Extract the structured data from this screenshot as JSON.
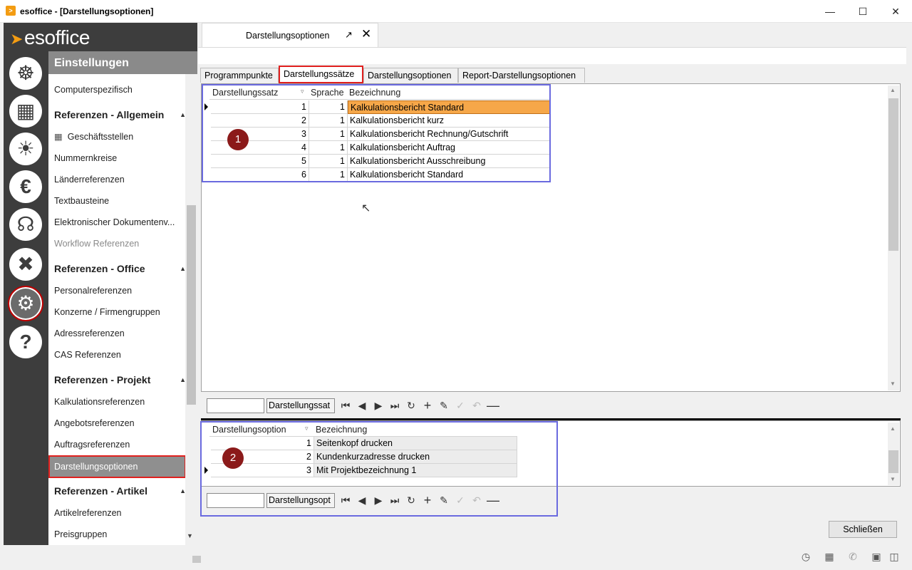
{
  "window": {
    "title": "esoffice - [Darstellungsoptionen]",
    "app_icon": "app-icon",
    "controls": [
      "minimize-icon",
      "maximize-icon",
      "close-icon"
    ]
  },
  "brand": {
    "logo_text": "esoffice",
    "accent": "#f39c12",
    "rail_color": "#3d3d3d"
  },
  "rail_icons": [
    {
      "name": "helm-icon",
      "glyph": "☸"
    },
    {
      "name": "calculator-icon",
      "glyph": "▦"
    },
    {
      "name": "alarm-light-icon",
      "glyph": "☀"
    },
    {
      "name": "euro-icon",
      "glyph": "€"
    },
    {
      "name": "headset-icon",
      "glyph": "☊"
    },
    {
      "name": "tools-icon",
      "glyph": "✖"
    },
    {
      "name": "gears-icon",
      "glyph": "⚙",
      "active": true
    },
    {
      "name": "help-icon",
      "glyph": "?"
    }
  ],
  "sidebar": {
    "header": "Einstellungen",
    "items": {
      "computerspezifisch": "Computerspezifisch",
      "group_allgemein": "Referenzen - Allgemein",
      "geschaeftsstellen": "Geschäftsstellen",
      "nummernkreise": "Nummernkreise",
      "laenderreferenzen": "Länderreferenzen",
      "textbausteine": "Textbausteine",
      "dokumentenv": "Elektronischer Dokumentenv...",
      "workflow": "Workflow Referenzen",
      "group_office": "Referenzen - Office",
      "personalreferenzen": "Personalreferenzen",
      "konzerne": "Konzerne / Firmengruppen",
      "adressreferenzen": "Adressreferenzen",
      "cas": "CAS Referenzen",
      "group_projekt": "Referenzen - Projekt",
      "kalkulationsreferenzen": "Kalkulationsreferenzen",
      "angebotsreferenzen": "Angebotsreferenzen",
      "auftragsreferenzen": "Auftragsreferenzen",
      "darstellungsoptionen": "Darstellungsoptionen",
      "group_artikel": "Referenzen - Artikel",
      "artikelreferenzen": "Artikelreferenzen",
      "preisgruppen": "Preisgruppen"
    }
  },
  "doc_tab": {
    "label": "Darstellungsoptionen"
  },
  "inner_tabs": [
    "Programmpunkte",
    "Darstellungssätze",
    "Darstellungsoptionen",
    "Report-Darstellungsoptionen"
  ],
  "grid1": {
    "columns": [
      "Darstellungssatz",
      "Sprache",
      "Bezeichnung"
    ],
    "rows": [
      [
        "1",
        "1",
        "Kalkulationsbericht Standard"
      ],
      [
        "2",
        "1",
        "Kalkulationsbericht kurz"
      ],
      [
        "3",
        "1",
        "Kalkulationsbericht Rechnung/Gutschrift"
      ],
      [
        "4",
        "1",
        "Kalkulationsbericht Auftrag"
      ],
      [
        "5",
        "1",
        "Kalkulationsbericht Ausschreibung"
      ],
      [
        "6",
        "1",
        "Kalkulationsbericht Standard"
      ]
    ],
    "badge": "1",
    "navigator_label": "Darstellungssat"
  },
  "grid2": {
    "columns": [
      "Darstellungsoption",
      "Bezeichnung"
    ],
    "rows": [
      [
        "1",
        "Seitenkopf drucken"
      ],
      [
        "2",
        "Kundenkurzadresse drucken"
      ],
      [
        "3",
        "Mit Projektbezeichnung 1"
      ]
    ],
    "badge": "2",
    "navigator_label": "Darstellungsopt"
  },
  "navigator_icons": [
    "first-icon",
    "prev-icon",
    "next-icon",
    "last-icon",
    "refresh-icon",
    "add-icon",
    "edit-icon",
    "post-icon",
    "cancel-icon",
    "delete-icon"
  ],
  "footer": {
    "close_label": "Schließen"
  },
  "status_icons": [
    "clock-icon",
    "building-icon",
    "phone-icon",
    "lock-icon",
    "database-icon"
  ]
}
